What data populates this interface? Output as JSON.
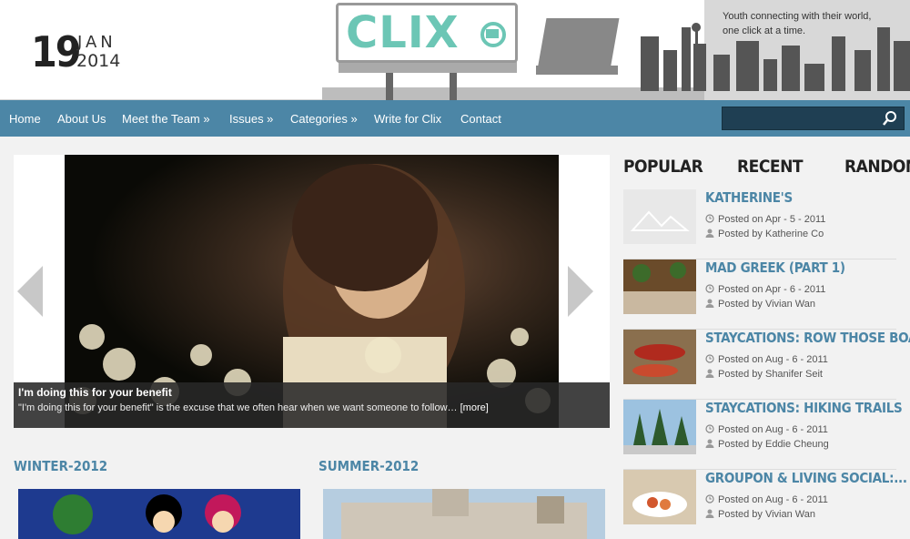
{
  "date": {
    "day": "19",
    "month": "JAN",
    "year": "2014"
  },
  "logo": {
    "text": "CLIX"
  },
  "tagline": {
    "line1": "Youth connecting with their world,",
    "line2": "one click at a time."
  },
  "nav": {
    "items": [
      "Home",
      "About Us",
      "Meet the Team »",
      "Issues »",
      "Categories »",
      "Write for Clix",
      "Contact"
    ],
    "search_placeholder": ""
  },
  "slider": {
    "caption_title": "I'm doing this for your benefit",
    "caption_text": "\"I'm doing this for your benefit\" is the excuse that we often hear when we want someone to follow…",
    "more": "[more]"
  },
  "sections": [
    {
      "title": "WINTER-2012"
    },
    {
      "title": "SUMMER-2012"
    }
  ],
  "tabs": [
    "POPULAR",
    "RECENT",
    "RANDOM"
  ],
  "posts": [
    {
      "title": "KATHERINE'S",
      "date": "Posted on Apr - 5 - 2011",
      "author": "Posted by Katherine Co"
    },
    {
      "title": "MAD GREEK (PART 1)",
      "date": "Posted on Apr - 6 - 2011",
      "author": "Posted by Vivian Wan"
    },
    {
      "title": "STAYCATIONS: ROW THOSE BOATS",
      "date": "Posted on Aug - 6 - 2011",
      "author": "Posted by Shanifer Seit"
    },
    {
      "title": "STAYCATIONS: HIKING TRAILS",
      "date": "Posted on Aug - 6 - 2011",
      "author": "Posted by Eddie Cheung"
    },
    {
      "title": "GROUPON & LIVING SOCIAL:...",
      "date": "Posted on Aug - 6 - 2011",
      "author": "Posted by Vivian Wan"
    }
  ],
  "colors": {
    "accent": "#4c86a6",
    "nav_bg": "#4c86a6",
    "logo": "#6cc6b5"
  }
}
